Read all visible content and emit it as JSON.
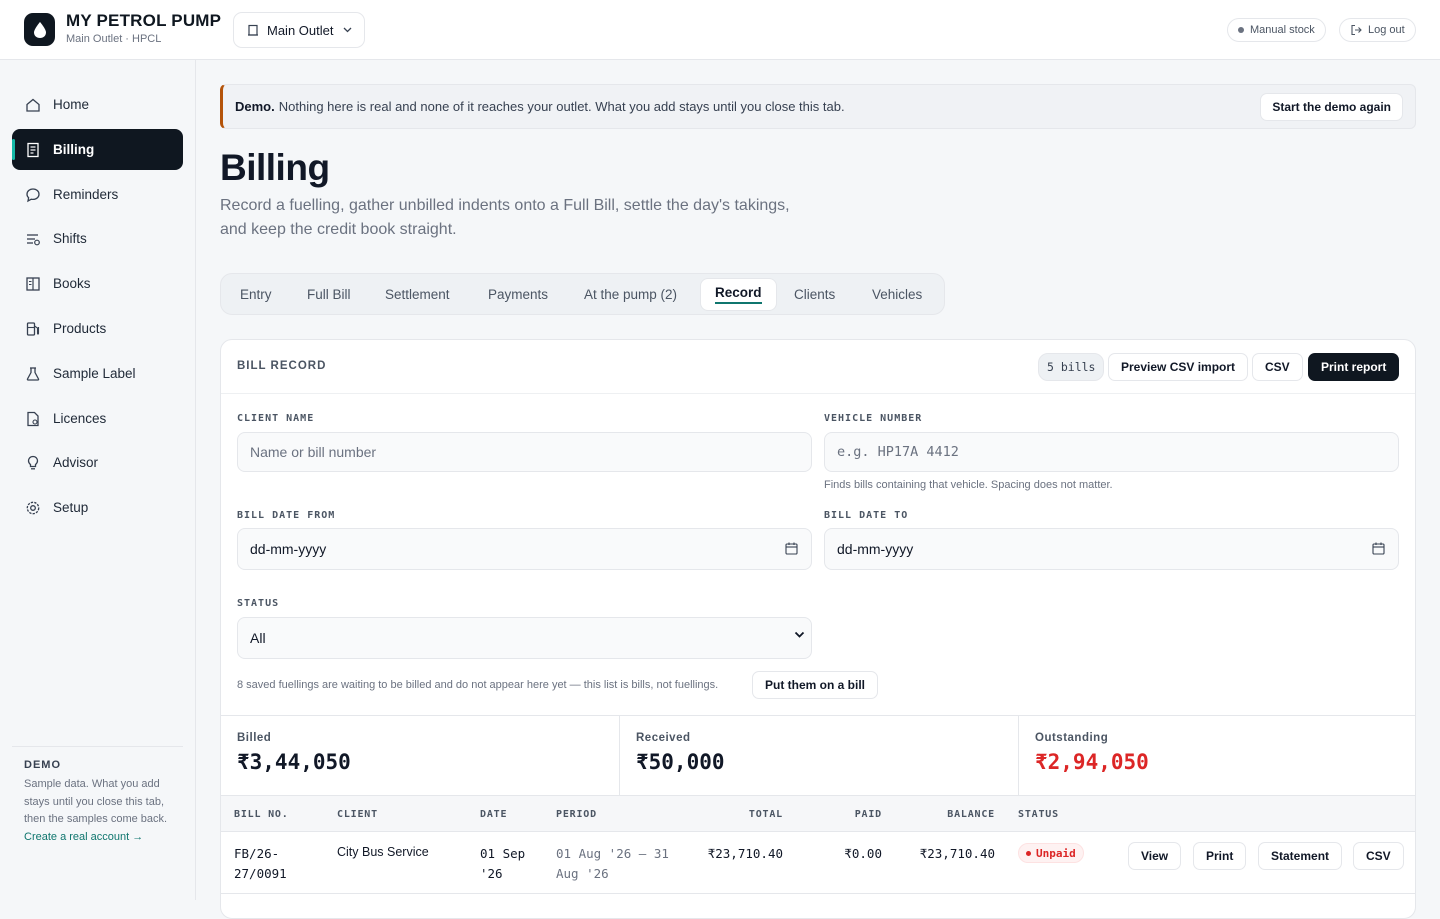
{
  "app": {
    "title": "MY PETROL PUMP",
    "subtitle": "Main Outlet · HPCL"
  },
  "header": {
    "outlet_select": "Main Outlet",
    "stock_mode": "Manual stock",
    "logout": "Log out"
  },
  "sidebar": {
    "items": [
      {
        "label": "Home",
        "icon": "home-icon"
      },
      {
        "label": "Billing",
        "icon": "receipt-icon"
      },
      {
        "label": "Reminders",
        "icon": "chat-icon"
      },
      {
        "label": "Shifts",
        "icon": "shifts-icon"
      },
      {
        "label": "Books",
        "icon": "book-icon"
      },
      {
        "label": "Products",
        "icon": "fuel-icon"
      },
      {
        "label": "Sample Label",
        "icon": "flask-icon"
      },
      {
        "label": "Licences",
        "icon": "licence-icon"
      },
      {
        "label": "Advisor",
        "icon": "bulb-icon"
      },
      {
        "label": "Setup",
        "icon": "gear-icon"
      }
    ],
    "active": "Billing",
    "demo": {
      "heading": "DEMO",
      "text": "Sample data. What you add stays until you close this tab, then the samples come back.",
      "link": "Create a real account →"
    }
  },
  "banner": {
    "strong": "Demo.",
    "text": "Nothing here is real and none of it reaches your outlet. What you add stays until you close this tab.",
    "button": "Start the demo again"
  },
  "page": {
    "title": "Billing",
    "description": "Record a fuelling, gather unbilled indents onto a Full Bill, settle the day's takings, and keep the credit book straight."
  },
  "tabs": [
    {
      "label": "Entry"
    },
    {
      "label": "Full Bill"
    },
    {
      "label": "Settlement"
    },
    {
      "label": "Payments"
    },
    {
      "label": "At the pump (2)"
    },
    {
      "label": "Record",
      "active": true
    },
    {
      "label": "Clients"
    },
    {
      "label": "Vehicles"
    }
  ],
  "record": {
    "title": "BILL RECORD",
    "count": "5 bills",
    "preview_csv": "Preview CSV import",
    "csv": "CSV",
    "print_report": "Print report",
    "filters": {
      "client_name": {
        "label": "CLIENT NAME",
        "placeholder": "Name or bill number"
      },
      "vehicle_number": {
        "label": "VEHICLE NUMBER",
        "placeholder": "e.g. HP17A 4412",
        "hint": "Finds bills containing that vehicle. Spacing does not matter."
      },
      "date_from": {
        "label": "BILL DATE FROM",
        "value": "dd-mm-yyyy"
      },
      "date_to": {
        "label": "BILL DATE TO",
        "value": "dd-mm-yyyy"
      },
      "status": {
        "label": "STATUS",
        "value": "All"
      }
    },
    "pending_note": "8 saved fuellings are waiting to be billed and do not appear here yet — this list is bills, not fuellings.",
    "pending_button": "Put them on a bill",
    "summary": {
      "billed": {
        "label": "Billed",
        "value": "₹3,44,050"
      },
      "received": {
        "label": "Received",
        "value": "₹50,000"
      },
      "outstanding": {
        "label": "Outstanding",
        "value": "₹2,94,050",
        "color": "#dc2626"
      }
    },
    "table": {
      "columns": [
        "BILL NO.",
        "CLIENT",
        "DATE",
        "PERIOD",
        "TOTAL",
        "PAID",
        "BALANCE",
        "STATUS"
      ],
      "rows": [
        {
          "bill_no_1": "FB/26-",
          "bill_no_2": "27/0091",
          "client": "City Bus Service",
          "date_1": "01 Sep",
          "date_2": "'26",
          "period_1": "01 Aug '26 – 31",
          "period_2": "Aug '26",
          "total": "₹23,710.40",
          "paid": "₹0.00",
          "balance": "₹23,710.40",
          "status": "Unpaid",
          "actions": {
            "view": "View",
            "print": "Print",
            "statement": "Statement",
            "csv": "CSV"
          }
        }
      ]
    }
  }
}
